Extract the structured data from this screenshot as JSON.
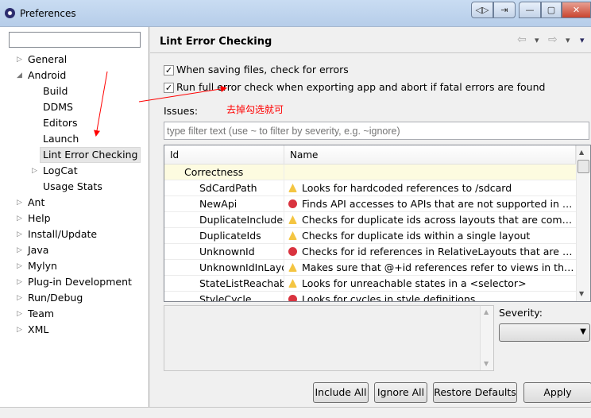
{
  "window": {
    "title": "Preferences",
    "buttons": [
      "◁▷",
      "⇥",
      "—",
      "▢",
      "✕"
    ]
  },
  "sidebar": {
    "filter_value": "",
    "items": [
      {
        "label": "General",
        "level": 0,
        "expander": "▷"
      },
      {
        "label": "Android",
        "level": 0,
        "expander": "◢"
      },
      {
        "label": "Build",
        "level": 1,
        "expander": ""
      },
      {
        "label": "DDMS",
        "level": 1,
        "expander": ""
      },
      {
        "label": "Editors",
        "level": 1,
        "expander": ""
      },
      {
        "label": "Launch",
        "level": 1,
        "expander": ""
      },
      {
        "label": "Lint Error Checking",
        "level": 1,
        "expander": "",
        "selected": true
      },
      {
        "label": "LogCat",
        "level": 1,
        "expander": "▷"
      },
      {
        "label": "Usage Stats",
        "level": 1,
        "expander": ""
      },
      {
        "label": "Ant",
        "level": 0,
        "expander": "▷"
      },
      {
        "label": "Help",
        "level": 0,
        "expander": "▷"
      },
      {
        "label": "Install/Update",
        "level": 0,
        "expander": "▷"
      },
      {
        "label": "Java",
        "level": 0,
        "expander": "▷"
      },
      {
        "label": "Mylyn",
        "level": 0,
        "expander": "▷"
      },
      {
        "label": "Plug-in Development",
        "level": 0,
        "expander": "▷"
      },
      {
        "label": "Run/Debug",
        "level": 0,
        "expander": "▷"
      },
      {
        "label": "Team",
        "level": 0,
        "expander": "▷"
      },
      {
        "label": "XML",
        "level": 0,
        "expander": "▷"
      }
    ]
  },
  "main": {
    "title": "Lint Error Checking",
    "nav": [
      "⇦",
      "▾",
      "⇨",
      "▾",
      "▾"
    ],
    "options": [
      {
        "label": "When saving files, check for errors",
        "checked": true
      },
      {
        "label": "Run full error check when exporting app and abort if fatal errors are found",
        "checked": true
      }
    ],
    "issues_label": "Issues:",
    "filter_placeholder": "type filter text (use ~ to filter by severity, e.g. ~ignore)",
    "table": {
      "columns": [
        "Id",
        "Name"
      ],
      "category": "Correctness",
      "rows": [
        {
          "id": "SdCardPath",
          "severity": "warning",
          "name": "Looks for hardcoded references to /sdcard"
        },
        {
          "id": "NewApi",
          "severity": "error",
          "name": "Finds API accesses to APIs that are not supported in all t..."
        },
        {
          "id": "DuplicateIncludedIds",
          "severity": "warning",
          "name": "Checks for duplicate ids across layouts that are combine..."
        },
        {
          "id": "DuplicateIds",
          "severity": "warning",
          "name": "Checks for duplicate ids within a single layout"
        },
        {
          "id": "UnknownId",
          "severity": "error",
          "name": "Checks for id references in RelativeLayouts that are not d..."
        },
        {
          "id": "UnknownIdInLayout",
          "severity": "warning",
          "name": "Makes sure that @+id references refer to views in the sa..."
        },
        {
          "id": "StateListReachable",
          "severity": "warning",
          "name": "Looks for unreachable states in a <selector>"
        },
        {
          "id": "StyleCycle",
          "severity": "error",
          "name": "Looks for cycles in style definitions"
        }
      ]
    },
    "severity_label": "Severity:",
    "severity_value": "",
    "buttons": {
      "include_all": "Include All",
      "ignore_all": "Ignore All",
      "restore_defaults": "Restore Defaults",
      "apply": "Apply"
    }
  },
  "annotation": {
    "text": "去掉勾选就可",
    "color": "#ff0000"
  }
}
